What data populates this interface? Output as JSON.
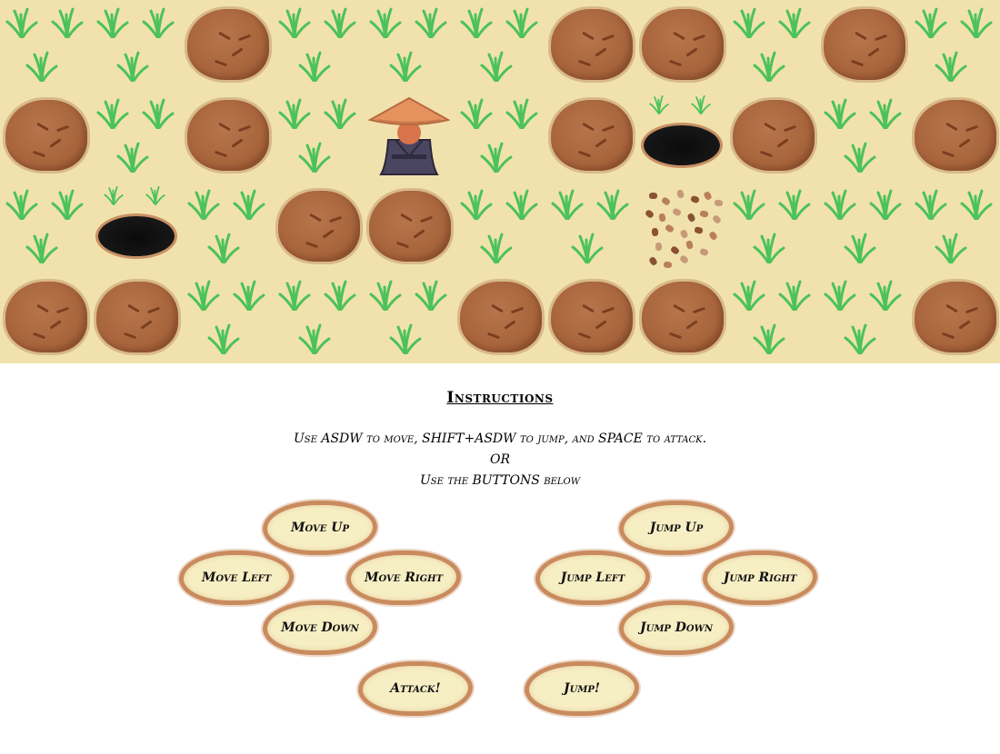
{
  "board": {
    "cols": 11,
    "rows": 4,
    "grid": [
      [
        "grass",
        "grass",
        "rock",
        "grass",
        "grass",
        "grass",
        "rock",
        "rock",
        "grass",
        "rock",
        "grass"
      ],
      [
        "rock",
        "grass",
        "rock",
        "grass",
        "player",
        "grass",
        "rock",
        "hole",
        "rock",
        "grass",
        "rock"
      ],
      [
        "grass",
        "hole",
        "grass",
        "rock",
        "rock",
        "grass",
        "grass",
        "rubble",
        "grass",
        "grass",
        "grass"
      ],
      [
        "rock",
        "rock",
        "grass",
        "grass",
        "grass",
        "rock",
        "rock",
        "rock",
        "grass",
        "grass",
        "rock"
      ]
    ],
    "colors": {
      "sand": "#f1e2ad",
      "rock": "#a8653c",
      "grass": "#4cc25a",
      "hole": "#111111"
    }
  },
  "instructions": {
    "title": "Instructions",
    "line1": "Use ASDW to move, SHIFT+ASDW to jump, and SPACE to attack.",
    "line2": "OR",
    "line3": "Use the BUTTONS below"
  },
  "buttons": {
    "move_up": "Move Up",
    "move_left": "Move Left",
    "move_right": "Move Right",
    "move_down": "Move Down",
    "jump_up": "Jump Up",
    "jump_left": "Jump Left",
    "jump_right": "Jump Right",
    "jump_down": "Jump Down",
    "attack": "Attack!",
    "jump": "Jump!"
  }
}
